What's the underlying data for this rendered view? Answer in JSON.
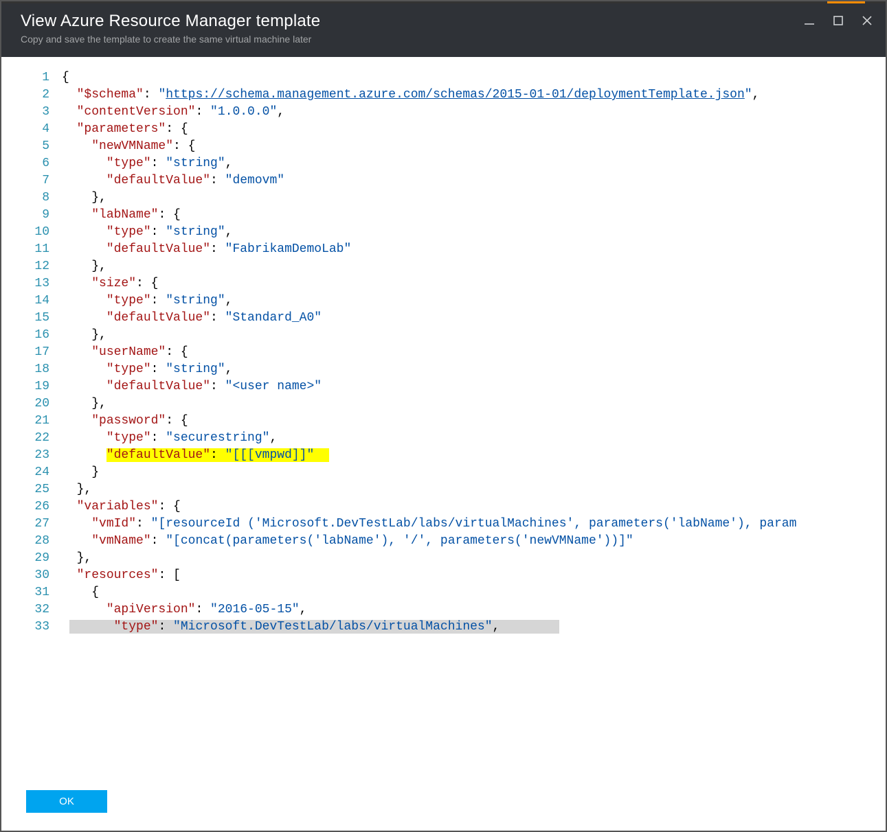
{
  "header": {
    "title": "View Azure Resource Manager template",
    "subtitle": "Copy and save the template to create the same virtual machine later"
  },
  "buttons": {
    "ok": "OK"
  },
  "code": {
    "lines": [
      {
        "n": 1,
        "i": 0,
        "t": [
          {
            "c": "p",
            "x": "{"
          }
        ]
      },
      {
        "n": 2,
        "i": 1,
        "t": [
          {
            "c": "k",
            "x": "\"$schema\""
          },
          {
            "c": "p",
            "x": ": "
          },
          {
            "c": "s",
            "x": "\""
          },
          {
            "c": "url",
            "x": "https://schema.management.azure.com/schemas/2015-01-01/deploymentTemplate.json"
          },
          {
            "c": "s",
            "x": "\""
          },
          {
            "c": "p",
            "x": ","
          }
        ]
      },
      {
        "n": 3,
        "i": 1,
        "t": [
          {
            "c": "k",
            "x": "\"contentVersion\""
          },
          {
            "c": "p",
            "x": ": "
          },
          {
            "c": "s",
            "x": "\"1.0.0.0\""
          },
          {
            "c": "p",
            "x": ","
          }
        ]
      },
      {
        "n": 4,
        "i": 1,
        "t": [
          {
            "c": "k",
            "x": "\"parameters\""
          },
          {
            "c": "p",
            "x": ": {"
          }
        ]
      },
      {
        "n": 5,
        "i": 2,
        "t": [
          {
            "c": "k",
            "x": "\"newVMName\""
          },
          {
            "c": "p",
            "x": ": {"
          }
        ]
      },
      {
        "n": 6,
        "i": 3,
        "t": [
          {
            "c": "k",
            "x": "\"type\""
          },
          {
            "c": "p",
            "x": ": "
          },
          {
            "c": "s",
            "x": "\"string\""
          },
          {
            "c": "p",
            "x": ","
          }
        ]
      },
      {
        "n": 7,
        "i": 3,
        "t": [
          {
            "c": "k",
            "x": "\"defaultValue\""
          },
          {
            "c": "p",
            "x": ": "
          },
          {
            "c": "s",
            "x": "\"demovm\""
          }
        ]
      },
      {
        "n": 8,
        "i": 2,
        "t": [
          {
            "c": "p",
            "x": "},"
          }
        ]
      },
      {
        "n": 9,
        "i": 2,
        "t": [
          {
            "c": "k",
            "x": "\"labName\""
          },
          {
            "c": "p",
            "x": ": {"
          }
        ]
      },
      {
        "n": 10,
        "i": 3,
        "t": [
          {
            "c": "k",
            "x": "\"type\""
          },
          {
            "c": "p",
            "x": ": "
          },
          {
            "c": "s",
            "x": "\"string\""
          },
          {
            "c": "p",
            "x": ","
          }
        ]
      },
      {
        "n": 11,
        "i": 3,
        "t": [
          {
            "c": "k",
            "x": "\"defaultValue\""
          },
          {
            "c": "p",
            "x": ": "
          },
          {
            "c": "s",
            "x": "\"FabrikamDemoLab\""
          }
        ]
      },
      {
        "n": 12,
        "i": 2,
        "t": [
          {
            "c": "p",
            "x": "},"
          }
        ]
      },
      {
        "n": 13,
        "i": 2,
        "t": [
          {
            "c": "k",
            "x": "\"size\""
          },
          {
            "c": "p",
            "x": ": {"
          }
        ]
      },
      {
        "n": 14,
        "i": 3,
        "t": [
          {
            "c": "k",
            "x": "\"type\""
          },
          {
            "c": "p",
            "x": ": "
          },
          {
            "c": "s",
            "x": "\"string\""
          },
          {
            "c": "p",
            "x": ","
          }
        ]
      },
      {
        "n": 15,
        "i": 3,
        "t": [
          {
            "c": "k",
            "x": "\"defaultValue\""
          },
          {
            "c": "p",
            "x": ": "
          },
          {
            "c": "s",
            "x": "\"Standard_A0\""
          }
        ]
      },
      {
        "n": 16,
        "i": 2,
        "t": [
          {
            "c": "p",
            "x": "},"
          }
        ]
      },
      {
        "n": 17,
        "i": 2,
        "t": [
          {
            "c": "k",
            "x": "\"userName\""
          },
          {
            "c": "p",
            "x": ": {"
          }
        ]
      },
      {
        "n": 18,
        "i": 3,
        "t": [
          {
            "c": "k",
            "x": "\"type\""
          },
          {
            "c": "p",
            "x": ": "
          },
          {
            "c": "s",
            "x": "\"string\""
          },
          {
            "c": "p",
            "x": ","
          }
        ]
      },
      {
        "n": 19,
        "i": 3,
        "t": [
          {
            "c": "k",
            "x": "\"defaultValue\""
          },
          {
            "c": "p",
            "x": ": "
          },
          {
            "c": "s",
            "x": "\"<user name>\""
          }
        ]
      },
      {
        "n": 20,
        "i": 2,
        "t": [
          {
            "c": "p",
            "x": "},"
          }
        ]
      },
      {
        "n": 21,
        "i": 2,
        "t": [
          {
            "c": "k",
            "x": "\"password\""
          },
          {
            "c": "p",
            "x": ": {"
          }
        ]
      },
      {
        "n": 22,
        "i": 3,
        "t": [
          {
            "c": "k",
            "x": "\"type\""
          },
          {
            "c": "p",
            "x": ": "
          },
          {
            "c": "s",
            "x": "\"securestring\""
          },
          {
            "c": "p",
            "x": ","
          }
        ]
      },
      {
        "n": 23,
        "i": 3,
        "hl": true,
        "t": [
          {
            "c": "k",
            "x": "\"defaultValue\""
          },
          {
            "c": "p",
            "x": ": "
          },
          {
            "c": "s",
            "x": "\"[[[vmpwd]]\""
          }
        ]
      },
      {
        "n": 24,
        "i": 2,
        "t": [
          {
            "c": "p",
            "x": "}"
          }
        ]
      },
      {
        "n": 25,
        "i": 1,
        "t": [
          {
            "c": "p",
            "x": "},"
          }
        ]
      },
      {
        "n": 26,
        "i": 1,
        "t": [
          {
            "c": "k",
            "x": "\"variables\""
          },
          {
            "c": "p",
            "x": ": {"
          }
        ]
      },
      {
        "n": 27,
        "i": 2,
        "t": [
          {
            "c": "k",
            "x": "\"vmId\""
          },
          {
            "c": "p",
            "x": ": "
          },
          {
            "c": "s",
            "x": "\"[resourceId ('Microsoft.DevTestLab/labs/virtualMachines', parameters('labName'), param"
          }
        ]
      },
      {
        "n": 28,
        "i": 2,
        "t": [
          {
            "c": "k",
            "x": "\"vmName\""
          },
          {
            "c": "p",
            "x": ": "
          },
          {
            "c": "s",
            "x": "\"[concat(parameters('labName'), '/', parameters('newVMName'))]\""
          }
        ]
      },
      {
        "n": 29,
        "i": 1,
        "t": [
          {
            "c": "p",
            "x": "},"
          }
        ]
      },
      {
        "n": 30,
        "i": 1,
        "t": [
          {
            "c": "k",
            "x": "\"resources\""
          },
          {
            "c": "p",
            "x": ": ["
          }
        ]
      },
      {
        "n": 31,
        "i": 2,
        "t": [
          {
            "c": "p",
            "x": "{"
          }
        ]
      },
      {
        "n": 32,
        "i": 3,
        "t": [
          {
            "c": "k",
            "x": "\"apiVersion\""
          },
          {
            "c": "p",
            "x": ": "
          },
          {
            "c": "s",
            "x": "\"2016-05-15\""
          },
          {
            "c": "p",
            "x": ","
          }
        ]
      },
      {
        "n": 33,
        "i": 3,
        "sel": true,
        "t": [
          {
            "c": "k",
            "x": "\"type\""
          },
          {
            "c": "p",
            "x": ": "
          },
          {
            "c": "s",
            "x": "\"Microsoft.DevTestLab/labs/virtualMachines\""
          },
          {
            "c": "p",
            "x": ","
          }
        ]
      }
    ]
  }
}
